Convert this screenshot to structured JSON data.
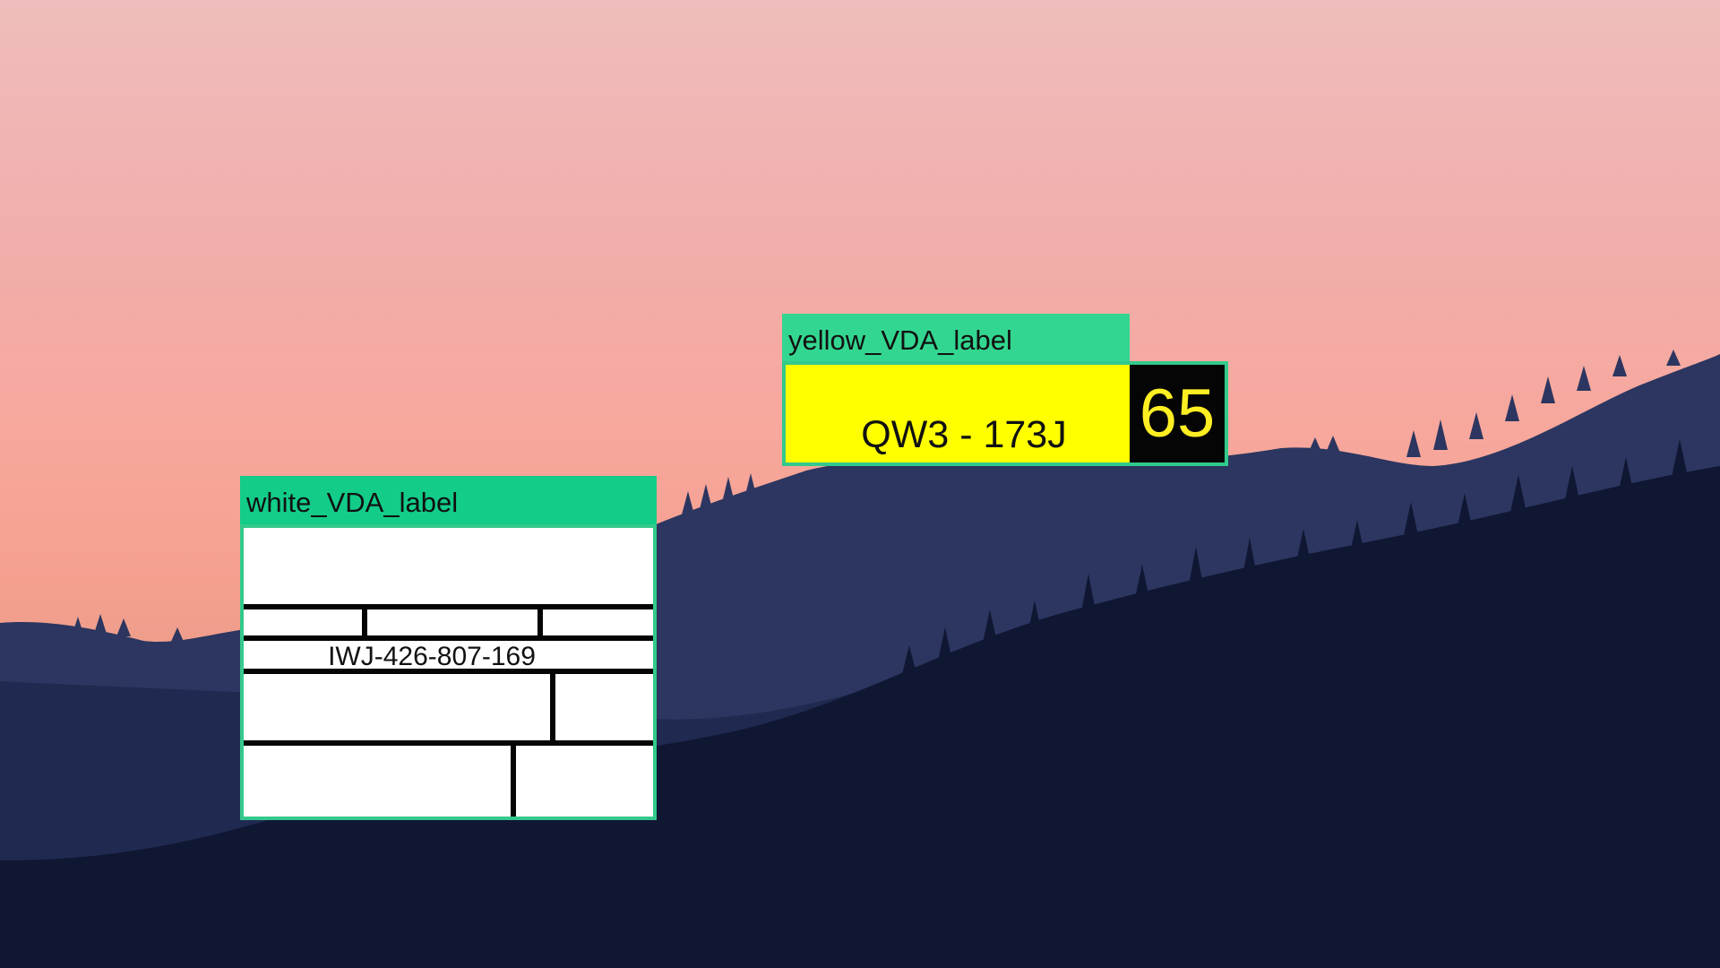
{
  "scene": {
    "description_colors": {
      "sky_top": "#efbdbd",
      "sky_bottom": "#f5a08f",
      "far_hills": "#2b3560",
      "near_hills": "#0f1733",
      "detection_box": "#33c98c",
      "yellow_label": "#ffff00",
      "white_label": "#ffffff"
    }
  },
  "detections": {
    "yellow": {
      "tag": "yellow_VDA_label",
      "code": "QW3 - 173J",
      "badge": "65"
    },
    "white": {
      "tag": "white_VDA_label",
      "code": "IWJ-426-807-169"
    }
  }
}
